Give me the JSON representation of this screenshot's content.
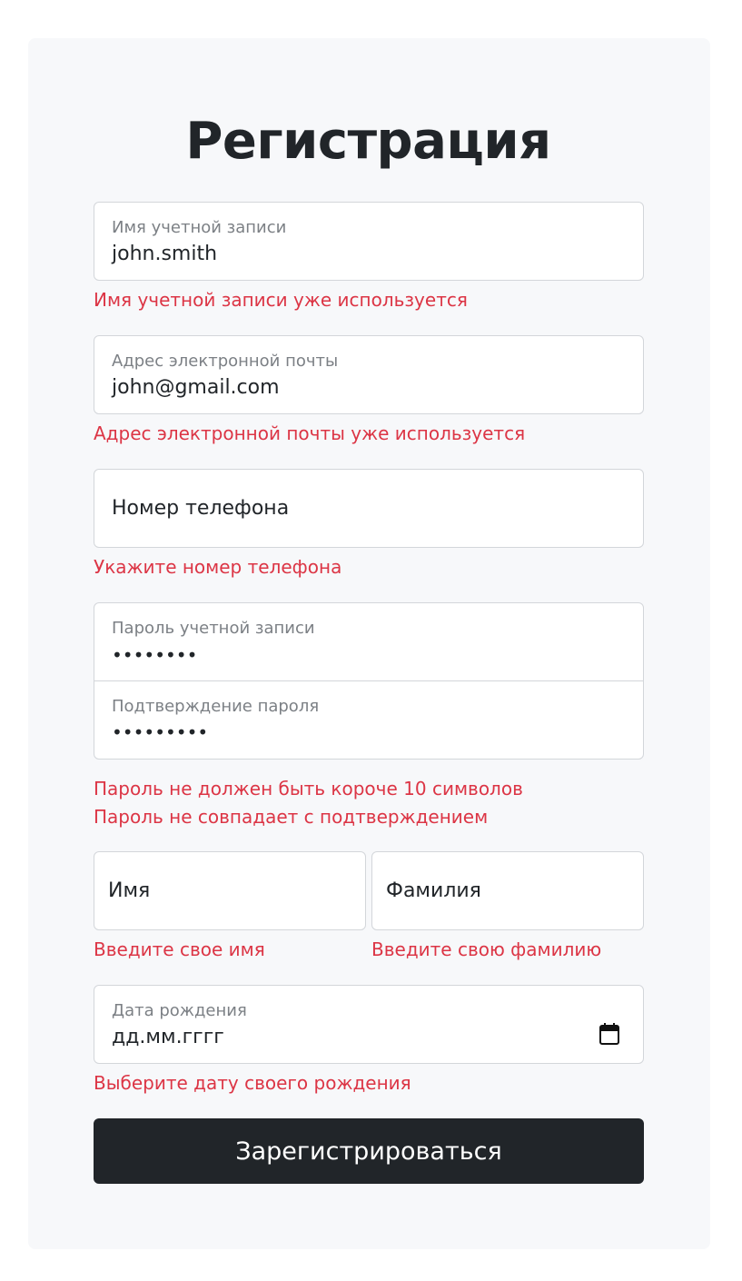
{
  "form": {
    "title": "Регистрация",
    "username": {
      "label": "Имя учетной записи",
      "value": "john.smith",
      "error": "Имя учетной записи уже используется"
    },
    "email": {
      "label": "Адрес электронной почты",
      "value": "john@gmail.com",
      "error": "Адрес электронной почты уже используется"
    },
    "phone": {
      "placeholder": "Номер телефона",
      "error": "Укажите номер телефона"
    },
    "password": {
      "label": "Пароль учетной записи",
      "value": "••••••••"
    },
    "password_confirm": {
      "label": "Подтверждение пароля",
      "value": "•••••••••"
    },
    "password_errors": [
      "Пароль не должен быть короче 10 символов",
      "Пароль не совпадает с подтверждением"
    ],
    "first_name": {
      "placeholder": "Имя",
      "error": "Введите свое имя"
    },
    "last_name": {
      "placeholder": "Фамилия",
      "error": "Введите свою фамилию"
    },
    "birth_date": {
      "label": "Дата рождения",
      "value": "дд.мм.гггг",
      "icon": "calendar-icon",
      "error": "Выберите дату своего рождения"
    },
    "submit_label": "Зарегистрироваться"
  },
  "colors": {
    "error": "#dc3545",
    "button": "#212529",
    "card_background": "#f7f8fa"
  }
}
